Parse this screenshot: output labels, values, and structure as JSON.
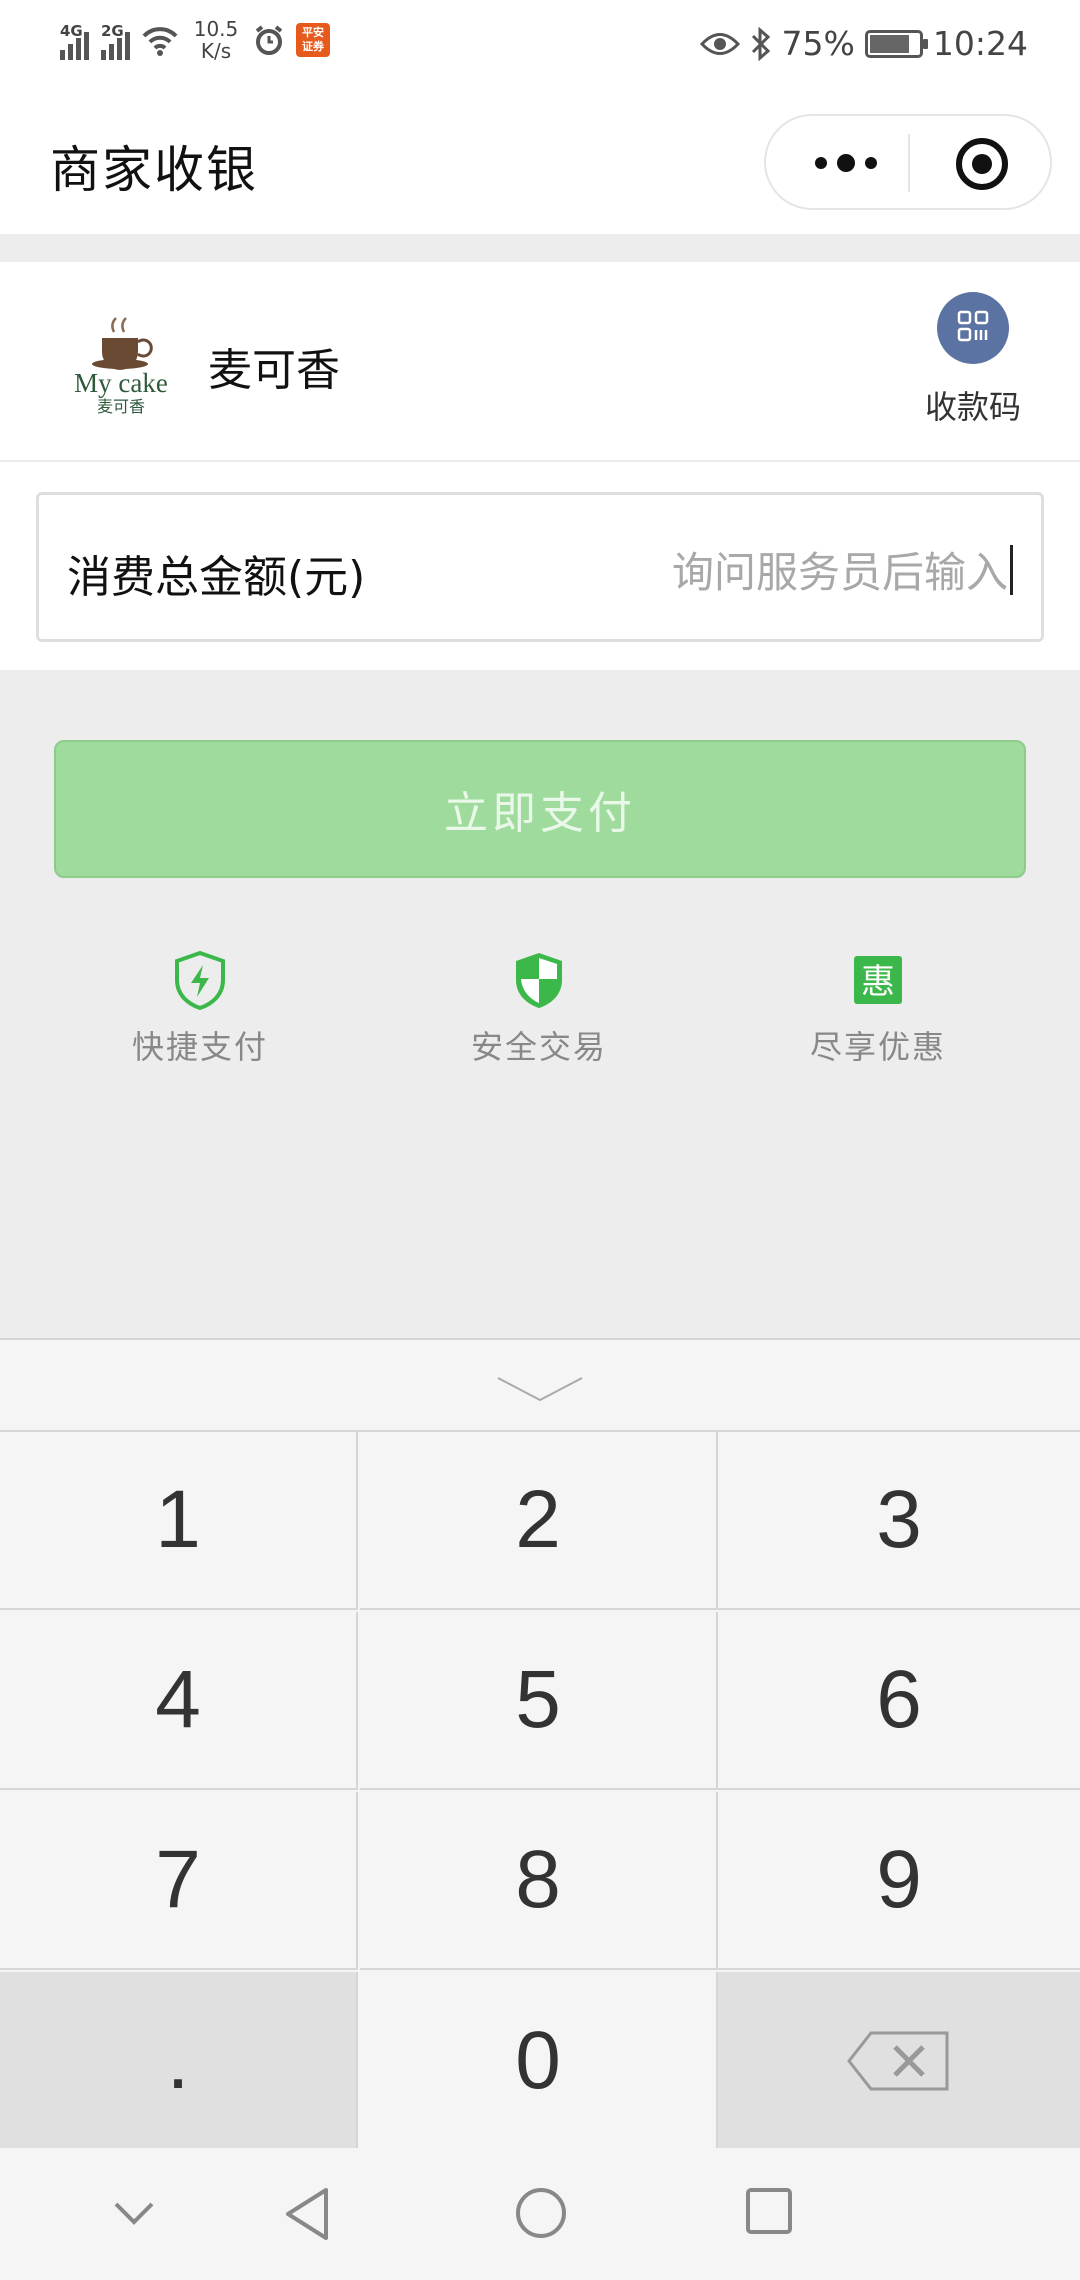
{
  "status_bar": {
    "net1": "4G",
    "net2": "2G",
    "speed_value": "10.5",
    "speed_unit": "K/s",
    "app_badge": "平安 证券",
    "battery_percent": "75%",
    "time": "10:24",
    "battery_level": 0.75
  },
  "header": {
    "title": "商家收银"
  },
  "merchant": {
    "name": "麦可香",
    "logo_text_en": "My cake",
    "logo_text_cn": "麦可香",
    "qr_label": "收款码"
  },
  "amount": {
    "label": "消费总金额(元)",
    "placeholder": "询问服务员后输入"
  },
  "pay_button": {
    "label": "立即支付"
  },
  "features": [
    {
      "label": "快捷支付",
      "icon": "lightning-shield-icon"
    },
    {
      "label": "安全交易",
      "icon": "security-shield-icon"
    },
    {
      "label": "尽享优惠",
      "icon": "discount-hui-icon",
      "glyph": "惠"
    }
  ],
  "keyboard": {
    "keys": [
      "1",
      "2",
      "3",
      "4",
      "5",
      "6",
      "7",
      "8",
      "9",
      ".",
      "0",
      "backspace"
    ]
  },
  "colors": {
    "brand_green": "#9edb9d",
    "icon_green": "#3cb84a",
    "qr_blue": "#5a73a2"
  }
}
